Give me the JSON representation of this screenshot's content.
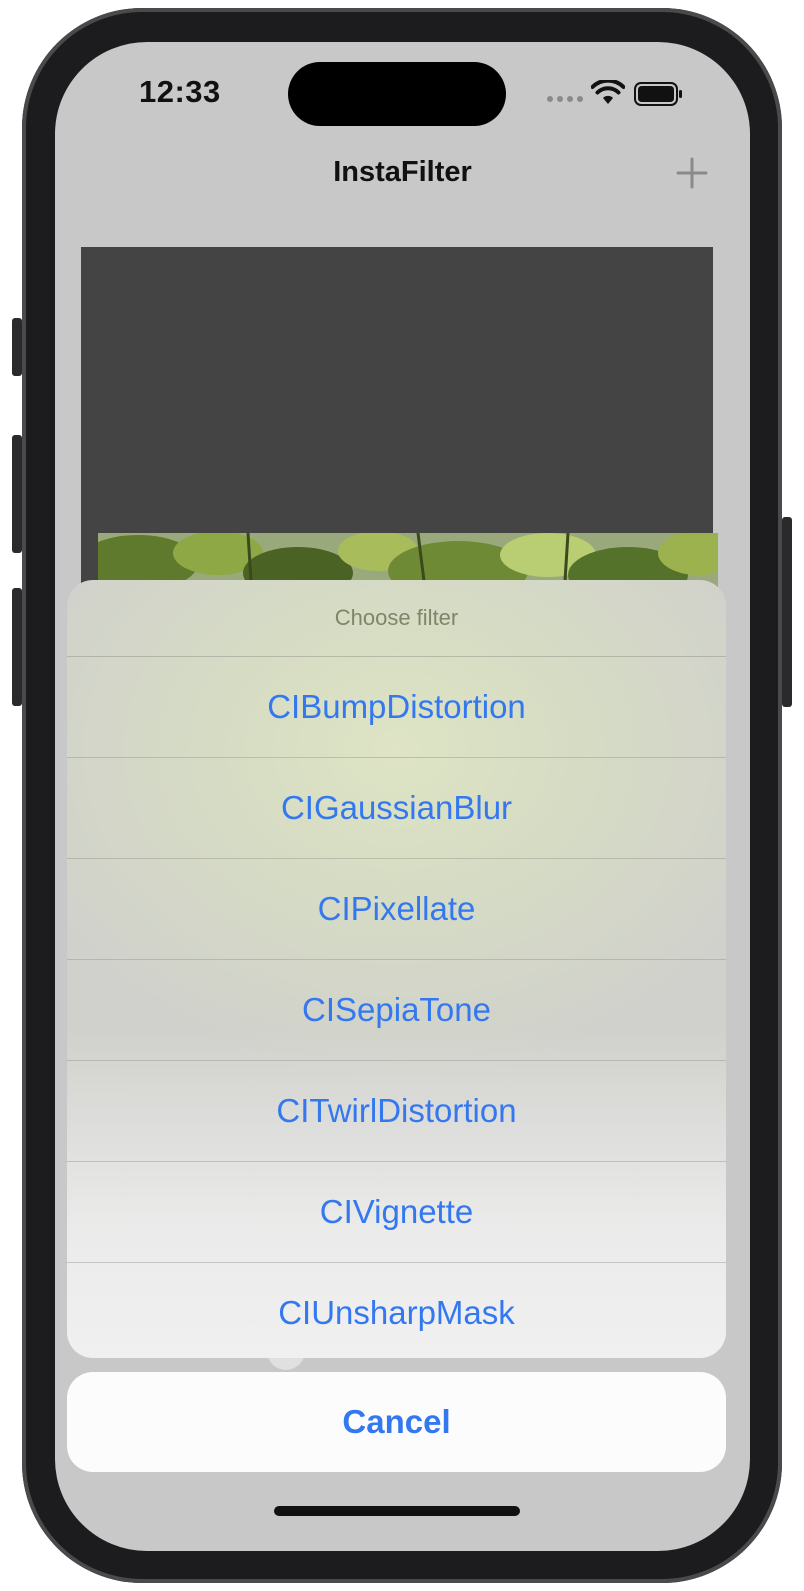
{
  "status_bar": {
    "time": "12:33"
  },
  "nav": {
    "title": "InstaFilter",
    "add_icon": "plus-icon"
  },
  "action_sheet": {
    "title": "Choose filter",
    "options": [
      "CIBumpDistortion",
      "CIGaussianBlur",
      "CIPixellate",
      "CISepiaTone",
      "CITwirlDistortion",
      "CIVignette",
      "CIUnsharpMask"
    ],
    "cancel_label": "Cancel"
  },
  "colors": {
    "accent": "#3478f0",
    "screen_bg": "#c8c8c8",
    "image_placeholder": "#444444"
  }
}
